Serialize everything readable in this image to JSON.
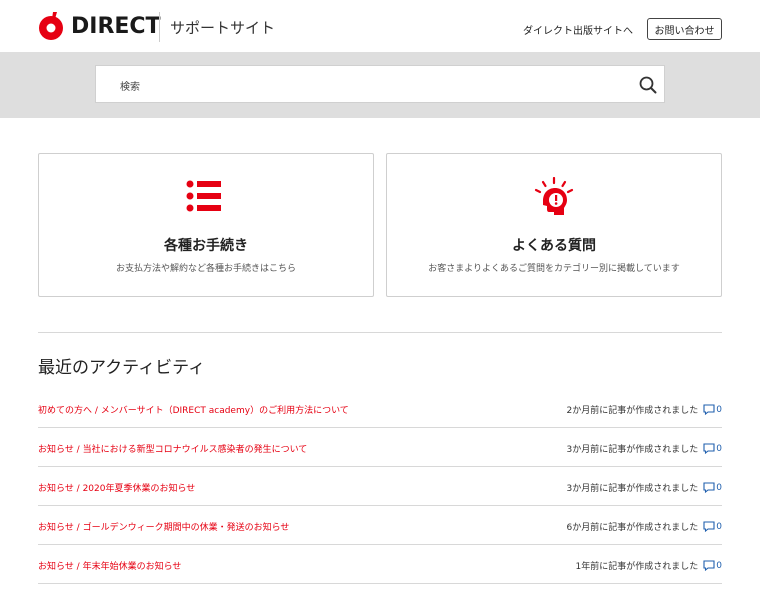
{
  "header": {
    "logo_text": "DIRECT",
    "site_name": "サポートサイト",
    "ext_link": "ダイレクト出版サイトへ",
    "contact_button": "お問い合わせ"
  },
  "search": {
    "placeholder": "検索"
  },
  "cards": [
    {
      "title": "各種お手続き",
      "description": "お支払方法や解約など各種お手続きはこちら"
    },
    {
      "title": "よくある質問",
      "description": "お客さまよりよくあるご質問をカテゴリー別に掲載しています"
    }
  ],
  "activity": {
    "title": "最近のアクティビティ",
    "items": [
      {
        "link": "初めての方へ / メンバーサイト（DIRECT academy）のご利用方法について",
        "meta": "2か月前に記事が作成されました",
        "comments": "0"
      },
      {
        "link": "お知らせ / 当社における新型コロナウイルス感染者の発生について",
        "meta": "3か月前に記事が作成されました",
        "comments": "0"
      },
      {
        "link": "お知らせ / 2020年夏季休業のお知らせ",
        "meta": "3か月前に記事が作成されました",
        "comments": "0"
      },
      {
        "link": "お知らせ / ゴールデンウィーク期間中の休業・発送のお知らせ",
        "meta": "6か月前に記事が作成されました",
        "comments": "0"
      },
      {
        "link": "お知らせ / 年末年始休業のお知らせ",
        "meta": "1年前に記事が作成されました",
        "comments": "0"
      }
    ]
  },
  "colors": {
    "brand_red": "#e60012",
    "comment_blue": "#1f5fae",
    "search_band": "#dedede"
  },
  "icons": {
    "logo": "direct-logo-icon",
    "search": "search-icon",
    "card_left": "list-icon",
    "card_right": "idea-head-icon",
    "comment": "comment-icon"
  }
}
